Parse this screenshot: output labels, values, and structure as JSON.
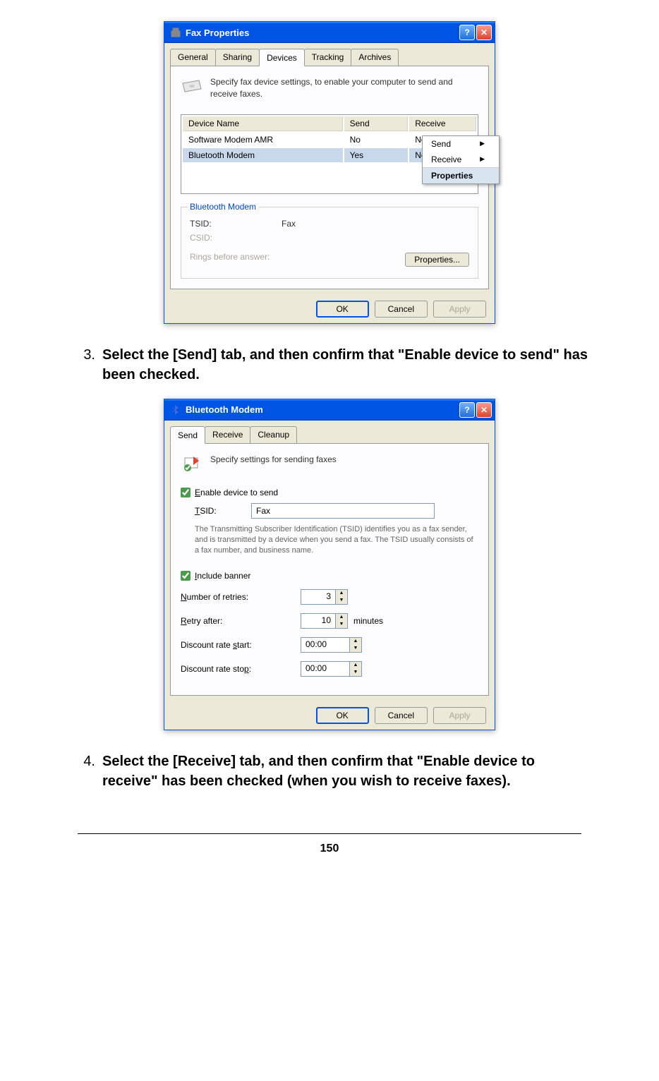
{
  "dialog1": {
    "title": "Fax Properties",
    "tabs": [
      "General",
      "Sharing",
      "Devices",
      "Tracking",
      "Archives"
    ],
    "active_tab": "Devices",
    "info_text": "Specify fax device settings, to enable your computer to send and receive faxes.",
    "table": {
      "headers": [
        "Device Name",
        "Send",
        "Receive"
      ],
      "rows": [
        {
          "name": "Software Modem AMR",
          "send": "No",
          "receive": "No",
          "selected": false
        },
        {
          "name": "Bluetooth Modem",
          "send": "Yes",
          "receive": "No",
          "selected": true
        }
      ]
    },
    "context_menu": {
      "items": [
        {
          "label": "Send",
          "submenu": true,
          "active": false
        },
        {
          "label": "Receive",
          "submenu": true,
          "active": false
        },
        {
          "label": "Properties",
          "submenu": false,
          "active": true
        }
      ]
    },
    "groupbox": {
      "label": "Bluetooth Modem",
      "tsid_label": "TSID:",
      "tsid_value": "Fax",
      "csid_label": "CSID:",
      "rings_label": "Rings before answer:",
      "props_btn": "Properties..."
    },
    "buttons": {
      "ok": "OK",
      "cancel": "Cancel",
      "apply": "Apply"
    }
  },
  "step3": {
    "num": "3.",
    "text": "Select the [Send] tab, and then confirm that \"Enable device to send\" has been checked."
  },
  "dialog2": {
    "title": "Bluetooth Modem",
    "tabs": [
      "Send",
      "Receive",
      "Cleanup"
    ],
    "active_tab": "Send",
    "info_text": "Specify settings for sending faxes",
    "enable_checkbox": "Enable device to send",
    "tsid_label": "TSID:",
    "tsid_value": "Fax",
    "tsid_desc": "The Transmitting Subscriber Identification (TSID) identifies you as a fax sender, and is transmitted by a device when you send a fax. The TSID usually consists of a fax number, and business name.",
    "include_banner": "Include banner",
    "retries_label": "Number of retries:",
    "retries_value": "3",
    "retry_after_label": "Retry after:",
    "retry_after_value": "10",
    "retry_unit": "minutes",
    "discount_start_label": "Discount rate start:",
    "discount_start_value": "00:00",
    "discount_stop_label": "Discount rate stop:",
    "discount_stop_value": "00:00",
    "buttons": {
      "ok": "OK",
      "cancel": "Cancel",
      "apply": "Apply"
    }
  },
  "step4": {
    "num": "4.",
    "text": "Select the [Receive] tab, and then confirm that \"Enable device to receive\" has been checked (when you wish to receive faxes)."
  },
  "page_number": "150"
}
